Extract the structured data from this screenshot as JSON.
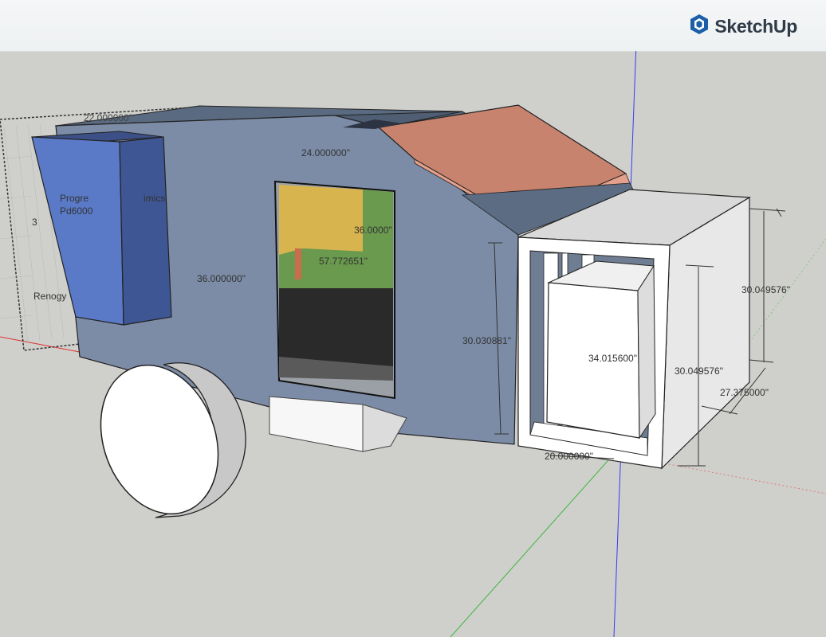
{
  "app": {
    "brand_name": "SketchUp",
    "logo_icon": "sketchup-logo-icon"
  },
  "model": {
    "colors": {
      "body": "#7c8ca6",
      "body_top": "#5f6f85",
      "roof": "#c8836e",
      "battery": "#5a7ac7",
      "wheel": "#ffffff",
      "box": "#f2f2f2",
      "window_yellow": "#d8b44f",
      "window_green": "#6a9a4e",
      "window_dark": "#2a2a2a"
    },
    "labels": {
      "battery_line1": "Progre",
      "battery_line2": "Pd6000",
      "battery_side": "imics",
      "battery_brand": "Renogy",
      "battery_left_num": "3"
    },
    "dimensions": {
      "top_left": "22.000000\"",
      "top_center": "24.000000\"",
      "side_center": "36.000000\"",
      "window_upper": "36.0000\"",
      "window_inner": "57.772651\"",
      "box_left": "30.030881\"",
      "box_center": "34.015600\"",
      "box_right_upper": "30.049576\"",
      "box_right_lower": "30.049576\"",
      "box_depth": "27.375000\"",
      "box_bottom": "20.000000\""
    }
  }
}
